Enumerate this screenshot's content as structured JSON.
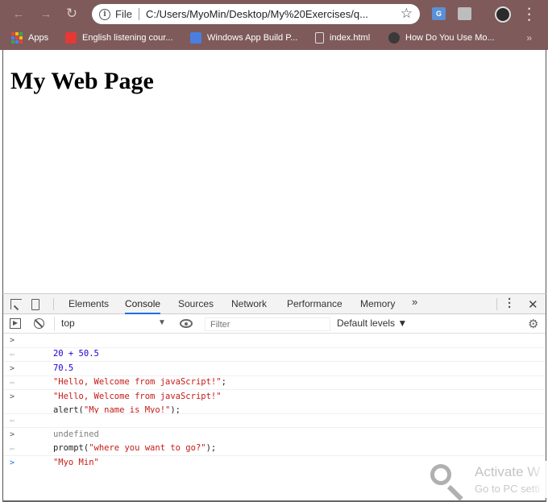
{
  "browser": {
    "scheme_label": "File",
    "url": "C:/Users/MyoMin/Desktop/My%20Exercises/q...",
    "bookmarks": [
      {
        "label": "Apps"
      },
      {
        "label": "English listening cour..."
      },
      {
        "label": "Windows App Build P..."
      },
      {
        "label": "index.html"
      },
      {
        "label": "How Do You Use Mo..."
      }
    ],
    "bookmarks_more": "»"
  },
  "page": {
    "heading": "My Web Page"
  },
  "devtools": {
    "tabs": [
      "Elements",
      "Console",
      "Sources",
      "Network",
      "Performance",
      "Memory"
    ],
    "active_tab": "Console",
    "more_tabs": "»",
    "context": "top",
    "filter_placeholder": "Filter",
    "levels": "Default levels ▼",
    "console": [
      {
        "kind": "input",
        "parts": [
          {
            "t": "num",
            "v": "20 + 50.5"
          }
        ]
      },
      {
        "kind": "output",
        "parts": [
          {
            "t": "num",
            "v": "70.5"
          }
        ]
      },
      {
        "kind": "input",
        "parts": [
          {
            "t": "str",
            "v": "\"Hello, Welcome from javaScript!\""
          },
          {
            "t": "plain",
            "v": ";"
          }
        ]
      },
      {
        "kind": "output",
        "parts": [
          {
            "t": "str",
            "v": "\"Hello, Welcome from javaScript!\""
          }
        ]
      },
      {
        "kind": "input",
        "parts": [
          {
            "t": "plain",
            "v": "alert("
          },
          {
            "t": "str",
            "v": "\"My name is Myo!\""
          },
          {
            "t": "plain",
            "v": ");"
          }
        ]
      },
      {
        "kind": "output",
        "parts": [
          {
            "t": "undef",
            "v": "undefined"
          }
        ]
      },
      {
        "kind": "input",
        "parts": [
          {
            "t": "plain",
            "v": "prompt("
          },
          {
            "t": "str",
            "v": "\"where you want to go?\""
          },
          {
            "t": "plain",
            "v": ");"
          }
        ]
      },
      {
        "kind": "output",
        "parts": [
          {
            "t": "str",
            "v": "\"Myo Min\""
          }
        ]
      }
    ]
  },
  "watermark": {
    "title": "Activate W",
    "subtitle": "Go to PC setti"
  },
  "colors": {
    "chrome_frame": "#7e5a5a",
    "console_number": "#1c00cf",
    "console_string": "#c41a16",
    "active_tab_underline": "#1a73e8"
  }
}
